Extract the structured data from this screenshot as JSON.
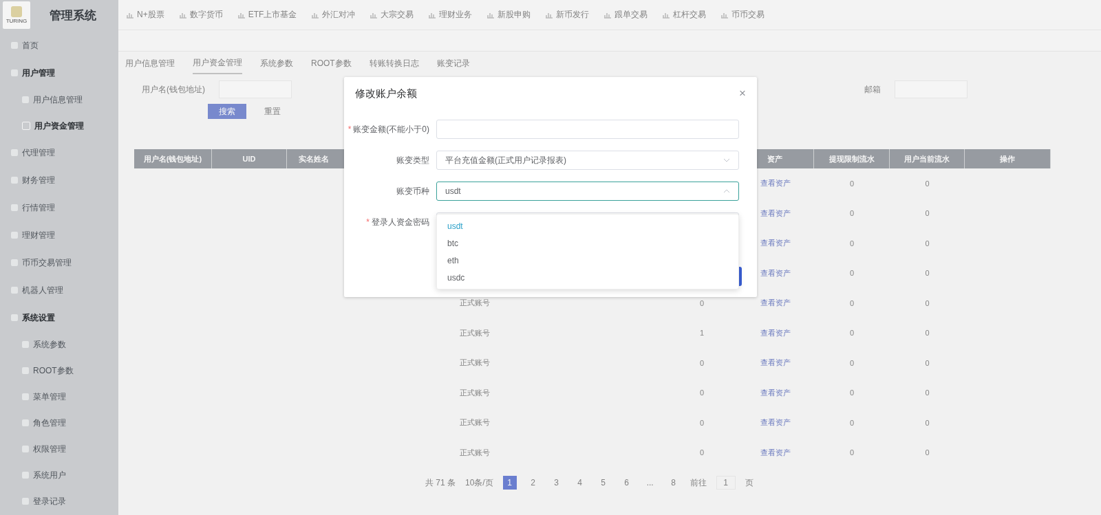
{
  "brand": {
    "logo_text": "TURING",
    "title": "管理系统"
  },
  "top_nav": [
    {
      "label": "N+股票"
    },
    {
      "label": "数字货币"
    },
    {
      "label": "ETF上市基金"
    },
    {
      "label": "外汇对冲"
    },
    {
      "label": "大宗交易"
    },
    {
      "label": "理财业务"
    },
    {
      "label": "新股申购"
    },
    {
      "label": "新币发行"
    },
    {
      "label": "跟单交易"
    },
    {
      "label": "杠杆交易"
    },
    {
      "label": "币币交易"
    }
  ],
  "sidebar": {
    "items": [
      {
        "label": "首页",
        "expanded": false,
        "selected": false
      },
      {
        "label": "用户管理",
        "expanded": true,
        "selected": false,
        "children": [
          {
            "label": "用户信息管理",
            "selected": false
          },
          {
            "label": "用户资金管理",
            "selected": true
          }
        ]
      },
      {
        "label": "代理管理",
        "expanded": false,
        "selected": false
      },
      {
        "label": "财务管理",
        "expanded": false,
        "selected": false
      },
      {
        "label": "行情管理",
        "expanded": false,
        "selected": false
      },
      {
        "label": "理财管理",
        "expanded": false,
        "selected": false
      },
      {
        "label": "币币交易管理",
        "expanded": false,
        "selected": false
      },
      {
        "label": "机器人管理",
        "expanded": false,
        "selected": false
      },
      {
        "label": "系统设置",
        "expanded": true,
        "selected": false,
        "children": [
          {
            "label": "系统参数",
            "selected": false
          },
          {
            "label": "ROOT参数",
            "selected": false
          },
          {
            "label": "菜单管理",
            "selected": false
          },
          {
            "label": "角色管理",
            "selected": false
          },
          {
            "label": "权限管理",
            "selected": false
          },
          {
            "label": "系统用户",
            "selected": false
          },
          {
            "label": "登录记录",
            "selected": false
          }
        ]
      }
    ]
  },
  "tabs": [
    {
      "label": "用户信息管理",
      "selected": false
    },
    {
      "label": "用户资金管理",
      "selected": true
    },
    {
      "label": "系统参数",
      "selected": false
    },
    {
      "label": "ROOT参数",
      "selected": false
    },
    {
      "label": "转账转换日志",
      "selected": false
    },
    {
      "label": "账变记录",
      "selected": false
    }
  ],
  "filter": {
    "label": "用户名(钱包地址)",
    "right_label": "邮箱",
    "search_button": "搜索",
    "reset_button": "重置"
  },
  "table": {
    "columns": [
      "用户名(钱包地址)",
      "UID",
      "实名姓名",
      "资产",
      "提现限制流水",
      "用户当前流水",
      "操作"
    ],
    "rows": [
      {
        "assets": "查看资产",
        "limit": "0",
        "current": "0"
      },
      {
        "assets": "查看资产",
        "limit": "0",
        "current": "0"
      },
      {
        "assets": "查看资产",
        "limit": "0",
        "current": "0"
      },
      {
        "assets": "查看资产",
        "limit": "0",
        "current": "0"
      },
      {
        "account_type": "正式账号",
        "balance": "0",
        "assets": "查看资产",
        "limit": "0",
        "current": "0"
      },
      {
        "account_type": "正式账号",
        "balance": "1",
        "assets": "查看资产",
        "limit": "0",
        "current": "0"
      },
      {
        "account_type": "正式账号",
        "balance": "0",
        "assets": "查看资产",
        "limit": "0",
        "current": "0"
      },
      {
        "account_type": "正式账号",
        "balance": "0",
        "assets": "查看资产",
        "limit": "0",
        "current": "0"
      },
      {
        "account_type": "正式账号",
        "balance": "0",
        "assets": "查看资产",
        "limit": "0",
        "current": "0"
      },
      {
        "account_type": "正式账号",
        "balance": "0",
        "assets": "查看资产",
        "limit": "0",
        "current": "0"
      }
    ]
  },
  "pagination": {
    "total": "共 71 条",
    "page_size": "10条/页",
    "pages": [
      {
        "label": "1",
        "selected": true
      },
      {
        "label": "2",
        "selected": false
      },
      {
        "label": "3",
        "selected": false
      },
      {
        "label": "4",
        "selected": false
      },
      {
        "label": "5",
        "selected": false
      },
      {
        "label": "6",
        "selected": false
      },
      {
        "label": "...",
        "selected": false
      },
      {
        "label": "8",
        "selected": false
      }
    ],
    "goto_label": "前往",
    "goto_value": "1",
    "goto_suffix": "页"
  },
  "modal": {
    "title": "修改账户余额",
    "close": "×",
    "fields": [
      {
        "kind": "input",
        "label": "账变金额(不能小于0)",
        "required_mark": "*"
      },
      {
        "kind": "select",
        "label": "账变类型",
        "value": "平台充值金额(正式用户记录报表)",
        "open": false
      },
      {
        "kind": "select",
        "label": "账变币种",
        "value": "usdt",
        "open": true
      },
      {
        "kind": "input",
        "label": "登录人资金密码",
        "required_mark": "*"
      }
    ],
    "dropdown": [
      {
        "label": "usdt",
        "selected": true
      },
      {
        "label": "btc",
        "selected": false
      },
      {
        "label": "eth",
        "selected": false
      },
      {
        "label": "usdc",
        "selected": false
      }
    ]
  }
}
